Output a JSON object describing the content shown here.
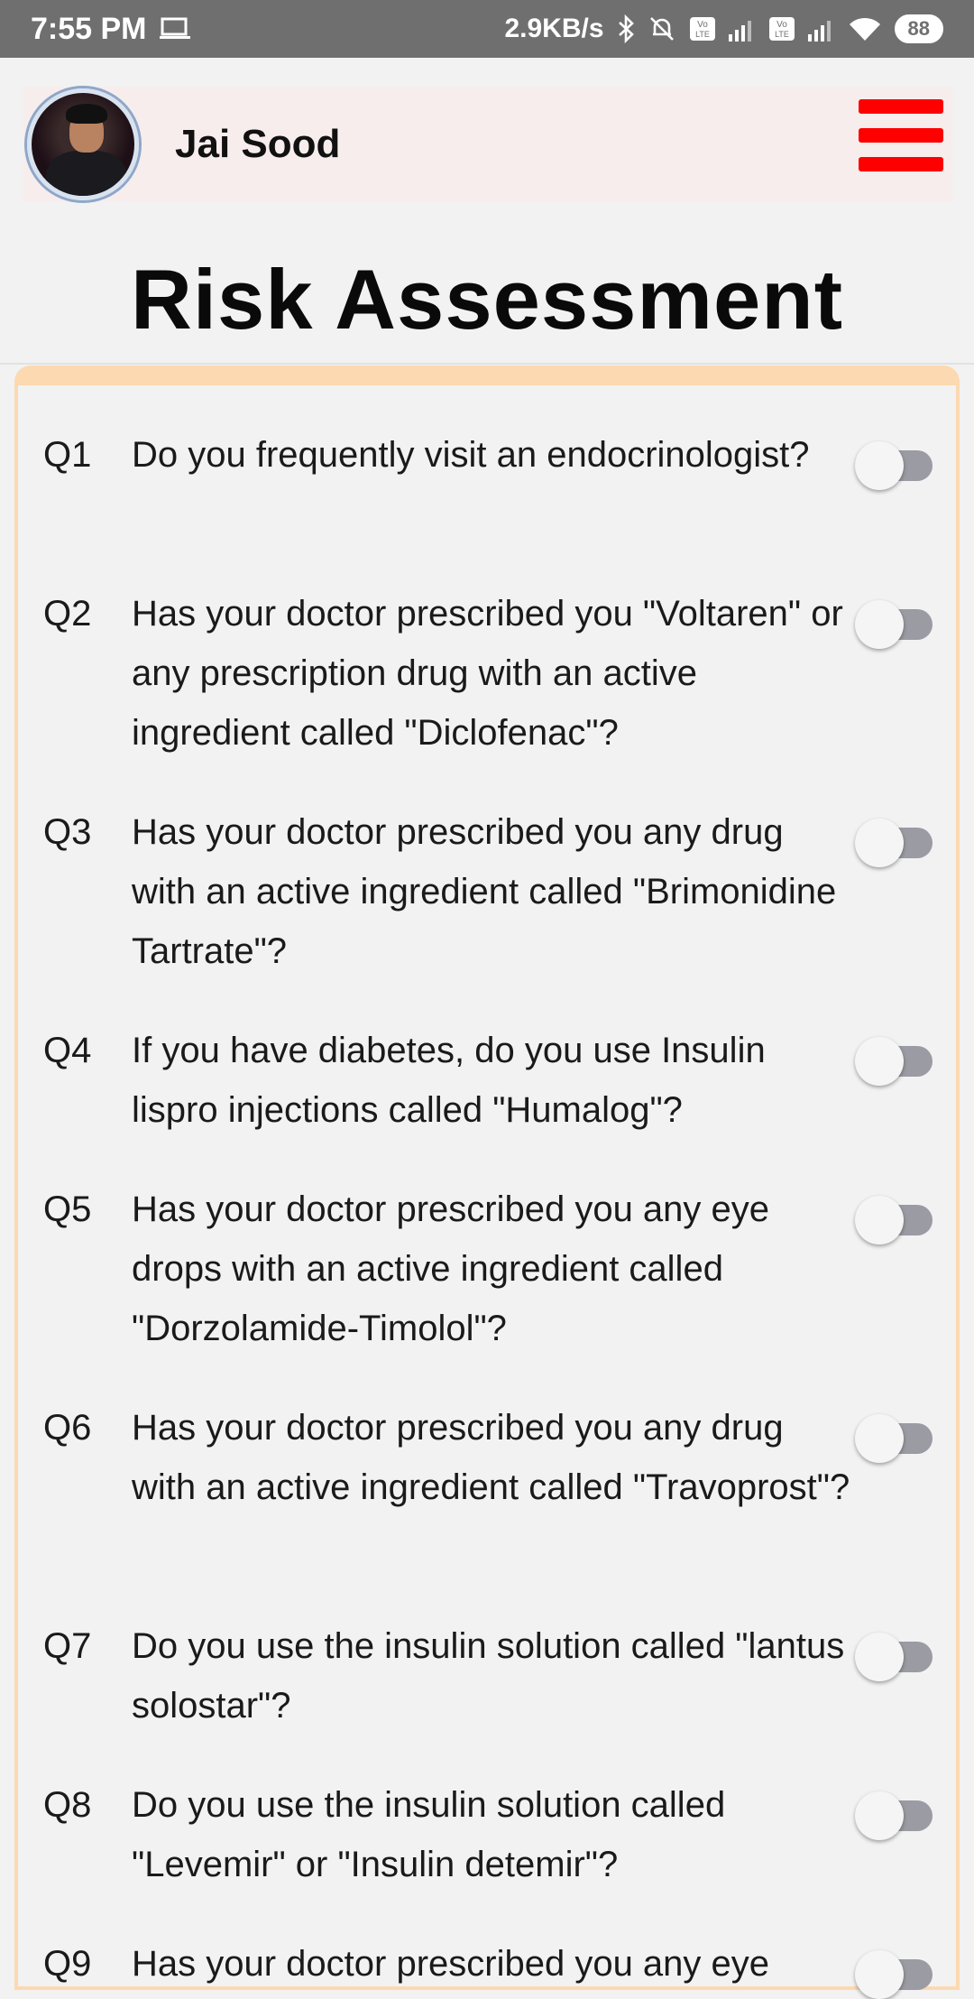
{
  "status_bar": {
    "time": "7:55 PM",
    "net_speed": "2.9KB/s",
    "battery": "88",
    "icons": [
      "screen-cast-icon",
      "bluetooth-icon",
      "mute-bell-icon",
      "volte-icon",
      "signal-icon",
      "volte-icon",
      "signal-icon",
      "wifi-icon",
      "battery-icon"
    ]
  },
  "profile": {
    "name": "Jai Sood",
    "menu_icon": "hamburger-menu-icon",
    "menu_color": "#ff0000"
  },
  "page": {
    "title": "Risk Assessment"
  },
  "questions": [
    {
      "num": "Q1",
      "text": "Do you frequently visit an endocrinologist?",
      "checked": false
    },
    {
      "num": "Q2",
      "text": "Has your doctor prescribed you \"Voltaren\" or any prescription drug with an active ingredient called \"Diclofenac\"?",
      "checked": false
    },
    {
      "num": "Q3",
      "text": "Has your doctor prescribed you any drug with an active ingredient called \"Brimonidine Tartrate\"?",
      "checked": false
    },
    {
      "num": "Q4",
      "text": "If you have diabetes, do you use Insulin lispro injections called \"Humalog\"?",
      "checked": false
    },
    {
      "num": "Q5",
      "text": "Has your doctor prescribed you any eye drops with an active ingredient called \"Dorzolamide-Timolol\"?",
      "checked": false
    },
    {
      "num": "Q6",
      "text": "Has your doctor prescribed you any drug with an active ingredient called \"Travoprost\"?",
      "checked": false
    },
    {
      "num": "Q7",
      "text": "Do you use the insulin solution called \"lantus solostar\"?",
      "checked": false
    },
    {
      "num": "Q8",
      "text": "Do you use the insulin solution called \"Levemir\" or \"Insulin detemir\"?",
      "checked": false
    },
    {
      "num": "Q9",
      "text": "Has your doctor prescribed you any eye",
      "checked": false
    }
  ],
  "colors": {
    "status_bar": "#6f6f6f",
    "card_border": "#fcd9b0",
    "toggle_track": "#9b9ba4",
    "profile_bg": "#f7eded"
  }
}
